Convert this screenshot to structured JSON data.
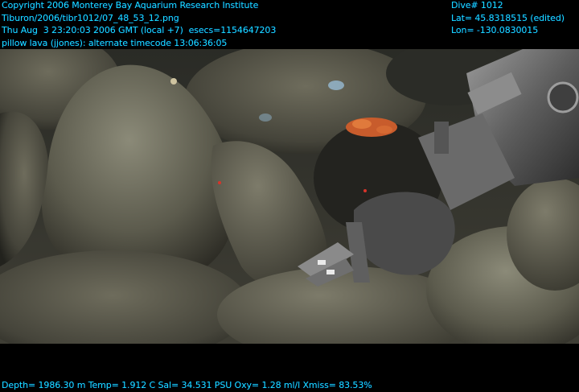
{
  "header_left": {
    "copyright": "Copyright 2006 Monterey Bay Aquarium Research Institute",
    "file_path": "Tiburon/2006/tibr1012/07_48_53_12.png",
    "datetime": "Thu Aug  3 23:20:03 2006 GMT (local +7)  esecs=1154647203",
    "annotation": "pillow lava (jjones): alternate timecode 13:06:36:05"
  },
  "header_right": {
    "dive": "Dive# 1012",
    "lat": "Lat= 45.8318515 (edited)",
    "lon": "Lon= -130.0830015"
  },
  "footer": {
    "telemetry": "Depth= 1986.30 m  Temp= 1.912 C  Sal= 34.531 PSU  Oxy= 1.28 ml/l  Xmiss= 83.53%"
  },
  "colors": {
    "overlay_text": "#19e6ff",
    "background": "#000000"
  }
}
